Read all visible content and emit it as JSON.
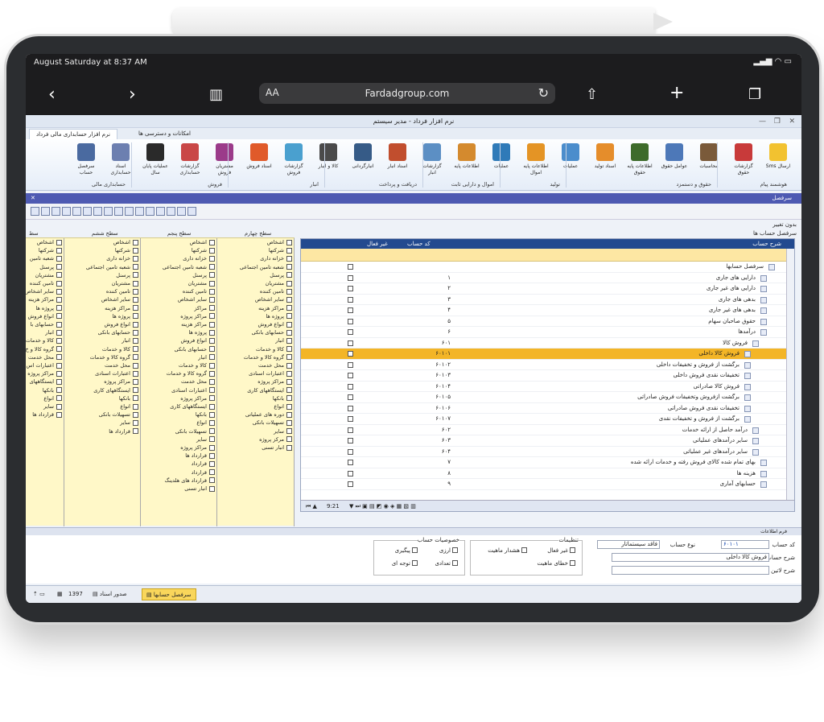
{
  "safari": {
    "status_time": "August Saturday at 8:37 AM",
    "text_size": "AA",
    "url": "Fardadgroup.com"
  },
  "app": {
    "window_title": "نرم افزار فرداد - مدیر سیستم",
    "ribbon_tabs": [
      "نرم افزار حسابداری مالی فرداد",
      "امکانات و دسترسی ها"
    ],
    "ribbon_buttons": [
      {
        "label": "Sms ارسال",
        "color": "#f2c230"
      },
      {
        "label": "گزارشات حقوق",
        "color": "#c83a3a"
      },
      {
        "label": "محاسبات",
        "color": "#7a5a3a"
      },
      {
        "label": "عوامل حقوق",
        "color": "#4d78b8"
      },
      {
        "label": "اطلاعات پایه حقوق",
        "color": "#3d6b2b"
      },
      {
        "label": "اسناد تولید",
        "color": "#e58d2b"
      },
      {
        "label": "عملیات",
        "color": "#4b8dcc"
      },
      {
        "label": "اطلاعات پایه اموال",
        "color": "#e49425"
      },
      {
        "label": "عملیات",
        "color": "#2f7ab8"
      },
      {
        "label": "اطلاعات پایه",
        "color": "#d48a2e"
      },
      {
        "label": "گزارشات انبار",
        "color": "#5c8fc4"
      },
      {
        "label": "اسناد انبار",
        "color": "#c14e2e"
      },
      {
        "label": "انبارگردانی",
        "color": "#365b87"
      },
      {
        "label": "کالا و انبار",
        "color": "#4a4a4a"
      },
      {
        "label": "گزارشات فروش",
        "color": "#4aa0cf"
      },
      {
        "label": "اسناد فروش",
        "color": "#e05a2a"
      },
      {
        "label": "مشتریان فروش",
        "color": "#9b3b8a"
      },
      {
        "label": "گزارشات حسابداری",
        "color": "#c94747"
      },
      {
        "label": "عملیات پایان سال",
        "color": "#2a2a2a"
      },
      {
        "label": "اسناد حسابداری",
        "color": "#6c7fb0"
      },
      {
        "label": "سرفصل حساب",
        "color": "#4a6aa0"
      }
    ],
    "ribbon_groups": [
      "هوشمند پیام",
      "حقوق و دستمزد",
      "تولید",
      "اموال و دارایی ثابت",
      "دریافت و پرداخت",
      "انبار",
      "فروش",
      "حسابداری مالی"
    ],
    "window_bar": "سرفصل",
    "edit_label": "بدون تغییر",
    "section_label": "سرفصل حساب ها",
    "filter_heads": [
      "سطح چهارم",
      "سطح پنجم",
      "سطح ششم",
      "سط"
    ],
    "filter_col4": [
      "اشخاص",
      "شرکتها",
      "خزانه داری",
      "شعبه تامین اجتماعی",
      "پرسنل",
      "مشتریان",
      "تامین کننده",
      "سایر اشخاص",
      "مراکز هزینه",
      "پروژه ها",
      "انواع فروش",
      "حسابهای بانکی",
      "انبار",
      "کالا و خدمات",
      "گروه کالا و خدمات",
      "محل خدمت",
      "اعتبارات اسنادی",
      "مراکز پروژه",
      "ایستگاههای کاری",
      "بانکها",
      "انواع",
      "دوره های عملیاتی",
      "تسهیلات بانکی",
      "سایر",
      "مرکز پروژه",
      "انبار تسنی"
    ],
    "filter_col5": [
      "اشخاص",
      "شرکتها",
      "خزانه داری",
      "شعبه تامین اجتماعی",
      "پرسنل",
      "مشتریان",
      "تامین کننده",
      "سایر اشخاص",
      "مراکز",
      "مراکز پروژه",
      "مراکز هزینه",
      "پروژه ها",
      "انواع فروش",
      "حسابهای بانکی",
      "انبار",
      "کالا و خدمات",
      "گروه کالا و خدمات",
      "محل خدمت",
      "اعتبارات اسنادی",
      "مراکز پروژه",
      "ایستگاههای کاری",
      "بانکها",
      "انواع",
      "تسهیلات بانکی",
      "سایر",
      "مراکز پروژه",
      "قرارداد ها",
      "قرارداد",
      "قرارداد",
      "قرارداد های هلدینگ",
      "انبار تسنی"
    ],
    "filter_col6": [
      "اشخاص",
      "شرکتها",
      "خزانه داری",
      "شعبه تامین اجتماعی",
      "پرسنل",
      "مشتریان",
      "تامین کننده",
      "سایر اشخاص",
      "مراکز هزینه",
      "پروژه ها",
      "انواع فروش",
      "حسابهای بانکی",
      "انبار",
      "کالا و خدمات",
      "گروه کالا و خدمات",
      "محل خدمت",
      "اعتبارات اسنادی",
      "مراکز پروژه",
      "ایستگاههای کاری",
      "بانکها",
      "انواع",
      "تسهیلات بانکی",
      "سایر",
      "قرارداد ها"
    ],
    "filter_col7": [
      "اشخاص",
      "شرکتها",
      "شعبه تامین",
      "پرسنل",
      "مشتریان",
      "تامین کننده",
      "سایر اشخاص",
      "مراکز هزینه",
      "پروژه ها",
      "انواع فروش",
      "حسابهای با",
      "انبار",
      "کالا و خدمات",
      "گروه کالا و خ",
      "محل خدمت",
      "اعتبارات اس",
      "مراکز پروژه",
      "ایستگاههای",
      "بانکها",
      "انواع",
      "سایر",
      "قرارداد ها"
    ],
    "tree_headers": {
      "desc": "شرح حساب",
      "code": "کد حساب",
      "inactive": "غیر فعال"
    },
    "tree_rows": [
      {
        "code": "",
        "name": "سرفصل حسابها",
        "level": 0
      },
      {
        "code": "۱",
        "name": "دارایی های جاری",
        "level": 1
      },
      {
        "code": "۲",
        "name": "دارایی های غیر جاری",
        "level": 1
      },
      {
        "code": "۳",
        "name": "بدهی های جاری",
        "level": 1
      },
      {
        "code": "۴",
        "name": "بدهی های غیر جاری",
        "level": 1
      },
      {
        "code": "۵",
        "name": "حقوق صاحبان سهام",
        "level": 1
      },
      {
        "code": "۶",
        "name": "درآمدها",
        "level": 1
      },
      {
        "code": "۶۰۱",
        "name": "فروش کالا",
        "level": 2
      },
      {
        "code": "۶۰۱۰۱",
        "name": "فروش کالا داخلی",
        "level": 3,
        "selected": true
      },
      {
        "code": "۶۰۱۰۲",
        "name": "برگشت از فروش و تخفیفات داخلی",
        "level": 3
      },
      {
        "code": "۶۰۱۰۳",
        "name": "تخفیفات نقدی فروش داخلی",
        "level": 3
      },
      {
        "code": "۶۰۱۰۴",
        "name": "فروش کالا صادراتی",
        "level": 3
      },
      {
        "code": "۶۰۱۰۵",
        "name": "برگشت ازفروش وتخفیفات فروش صادراتی",
        "level": 3
      },
      {
        "code": "۶۰۱۰۶",
        "name": "تخفیفات نقدی فروش صادراتی",
        "level": 3
      },
      {
        "code": "۶۰۱۰۷",
        "name": "برگشت از فروش و تخفیفات نقدی",
        "level": 3
      },
      {
        "code": "۶۰۲",
        "name": "درآمد حاصل از ارائه خدمات",
        "level": 2
      },
      {
        "code": "۶۰۳",
        "name": "سایر درآمدهای عملیاتی",
        "level": 2
      },
      {
        "code": "۶۰۴",
        "name": "سایر درآمدهای غیر عملیاتی",
        "level": 2
      },
      {
        "code": "۷",
        "name": "بهای تمام شده کالای فروش رفته و خدمات ارائه شده",
        "level": 1
      },
      {
        "code": "۸",
        "name": "هزینه ها",
        "level": 1
      },
      {
        "code": "۹",
        "name": "حسابهای آماری",
        "level": 1
      }
    ],
    "tree_footer_time": "9:21",
    "bottom_bar": "فرم اطلاعات",
    "form": {
      "code_label": "کد حساب",
      "code_value": "۶۰۱۰۱",
      "type_label": "نوع حساب",
      "type_value": "فاقد سیستماتار",
      "desc_label": "شرح حساب",
      "desc_value": "فروش کالا داخلی",
      "latin_label": "شرح لاتین حساب",
      "settings_title": "تنظیمات",
      "inactive": "غیر فعال",
      "nature_warning": "هشدار ماهیت",
      "nature_error": "خطای ماهیت",
      "props_title": "خصوصیات حساب",
      "foreign": "ارزی",
      "follow": "پیگیری",
      "quantity": "تعدادی",
      "attention": "توجه ای"
    },
    "taskbar": {
      "active_tab": "سرفصل حسابها",
      "docs_tab": "صدور اسناد",
      "year": "1397"
    }
  }
}
